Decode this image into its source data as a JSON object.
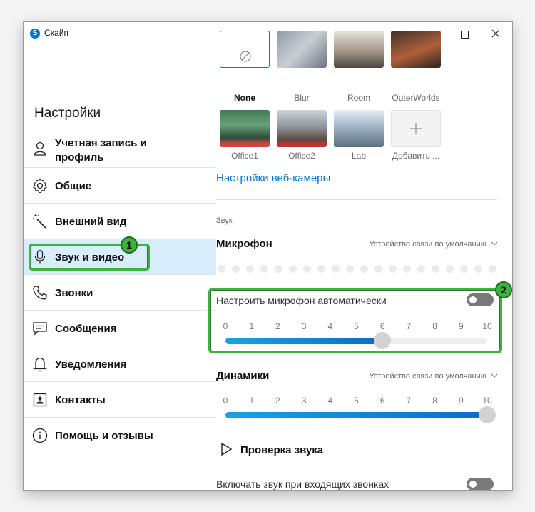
{
  "window": {
    "app_title": "Скайп",
    "logo_letter": "S"
  },
  "sidebar": {
    "title": "Настройки",
    "items": [
      {
        "label": "Учетная запись и профиль",
        "icon": "person-icon"
      },
      {
        "label": "Общие",
        "icon": "gear-icon"
      },
      {
        "label": "Внешний вид",
        "icon": "magic-wand-icon"
      },
      {
        "label": "Звук и видео",
        "icon": "microphone-icon",
        "active": true
      },
      {
        "label": "Звонки",
        "icon": "phone-icon"
      },
      {
        "label": "Сообщения",
        "icon": "message-icon"
      },
      {
        "label": "Уведомления",
        "icon": "bell-icon"
      },
      {
        "label": "Контакты",
        "icon": "contacts-icon"
      },
      {
        "label": "Помощь и отзывы",
        "icon": "info-icon"
      }
    ],
    "annotation_badge": "1"
  },
  "video": {
    "backgrounds_row1": [
      {
        "label": "None",
        "selected": true
      },
      {
        "label": "Blur"
      },
      {
        "label": "Room"
      },
      {
        "label": "OuterWorlds"
      }
    ],
    "backgrounds_row2": [
      {
        "label": "Office1"
      },
      {
        "label": "Office2"
      },
      {
        "label": "Lab"
      },
      {
        "label": "Добавить ..."
      }
    ],
    "webcam_settings_link": "Настройки веб-камеры"
  },
  "audio": {
    "section_label": "Звук",
    "microphone": {
      "title": "Микрофон",
      "device": "Устройство связи по умолчанию",
      "auto_adjust_label": "Настроить микрофон автоматически",
      "auto_adjust_enabled": false,
      "level": 6,
      "annotation_badge": "2"
    },
    "speakers": {
      "title": "Динамики",
      "device": "Устройство связи по умолчанию",
      "level": 10
    },
    "scale_ticks": [
      "0",
      "1",
      "2",
      "3",
      "4",
      "5",
      "6",
      "7",
      "8",
      "9",
      "10"
    ],
    "check_sound_label": "Проверка звука",
    "incoming_calls_label": "Включать звук при входящих звонках",
    "incoming_calls_enabled": false
  },
  "colors": {
    "accent": "#0078d4",
    "annotation_green": "#3db33d",
    "active_nav_bg": "#d9eefc"
  }
}
